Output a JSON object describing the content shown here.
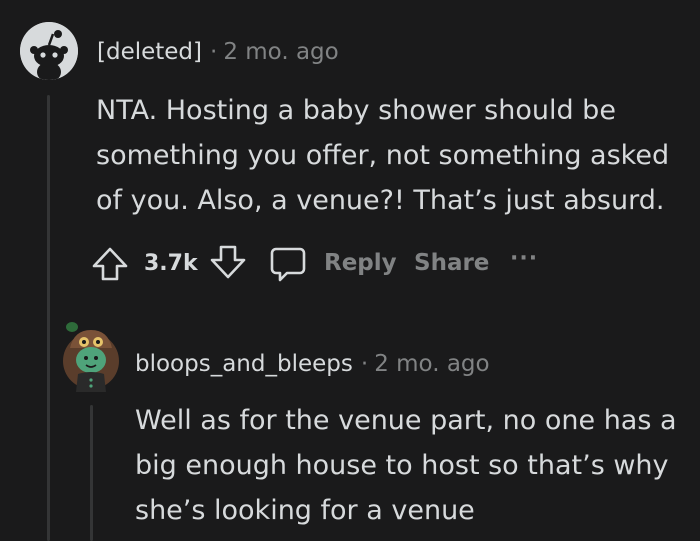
{
  "comment": {
    "author": "[deleted]",
    "separator": "·",
    "time": "2 mo. ago",
    "body_lines": [
      "NTA. Hosting a baby shower should be",
      "something you offer, not something asked",
      "of you. Also, a venue?! That’s just absurd."
    ],
    "score": "3.7k",
    "reply_label": "Reply",
    "share_label": "Share",
    "more_label": "···"
  },
  "reply": {
    "author": "bloops_and_bleeps",
    "separator": "·",
    "time": "2 mo. ago",
    "body_lines": [
      "Well as for the venue part, no one has a",
      "big enough house to host so that’s why",
      "she’s looking for a venue"
    ]
  },
  "colors": {
    "background": "#1a1a1b",
    "text": "#d7dadc",
    "muted": "#818384",
    "thread_line": "#343536"
  },
  "icons": {
    "upvote": "arrow-up-icon",
    "downvote": "arrow-down-icon",
    "reply": "speech-bubble-icon",
    "more": "ellipsis-icon"
  }
}
